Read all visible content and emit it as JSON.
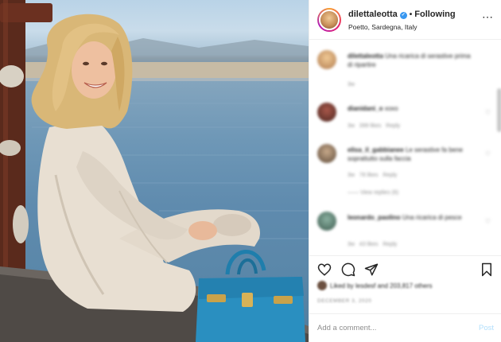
{
  "post": {
    "username": "dilettaleotta",
    "verified_badge": "✓",
    "separator": "•",
    "follow_status": "Following",
    "location": "Poetto, Sardegna, Italy",
    "more_icon": "⋯"
  },
  "comments": [
    {
      "user": "dilettaleotta",
      "text": "Una ricarica di serastive prima di ripartire",
      "time": "3w",
      "likes": "",
      "reply": ""
    },
    {
      "user": "dianidani_o",
      "text": "xoxo",
      "time": "3w",
      "likes": "399 likes",
      "reply": "Reply"
    },
    {
      "user": "elisa_il_gabbianee",
      "text": "Le serastive fa bene soprattutto sulla faccia",
      "time": "3w",
      "likes": "78 likes",
      "reply": "Reply",
      "view_replies": "View replies (6)"
    },
    {
      "user": "leonardo_paolino",
      "text": "Una ricarica di pesce",
      "time": "3w",
      "likes": "43 likes",
      "reply": "Reply"
    }
  ],
  "actions": {
    "like_icon": "heart-icon",
    "comment_icon": "comment-icon",
    "share_icon": "share-icon",
    "save_icon": "bookmark-icon"
  },
  "likes": {
    "text": "Liked by lesdesf and 203,817 others"
  },
  "date": {
    "text": "DECEMBER 3, 2020"
  },
  "add_comment": {
    "placeholder": "Add a comment...",
    "post_label": "Post"
  },
  "colors": {
    "accent": "#3897f0",
    "post_disabled": "#b2dffc",
    "bag": "#2a8fc0",
    "coat": "#e8dfd2"
  }
}
